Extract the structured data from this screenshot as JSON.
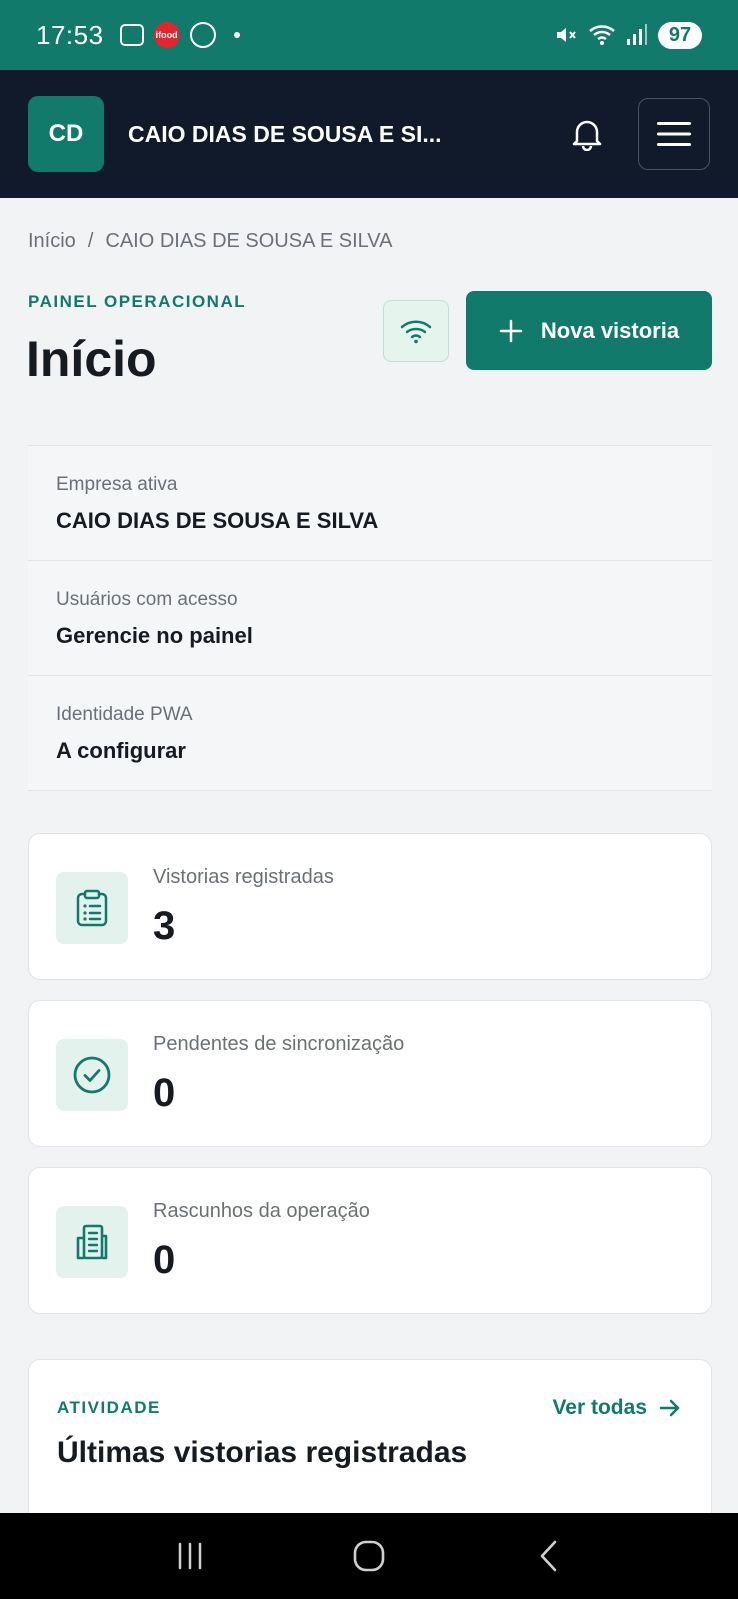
{
  "status_bar": {
    "time": "17:53",
    "battery": "97",
    "notification_icons": [
      "gallery-icon",
      "ifood-icon",
      "whatsapp-icon"
    ],
    "ifood_label": "ifood"
  },
  "header": {
    "avatar_initials": "CD",
    "company_name": "CAIO DIAS DE SOUSA E SI..."
  },
  "breadcrumb": {
    "home": "Início",
    "separator": "/",
    "current": "CAIO DIAS DE SOUSA E SILVA"
  },
  "page": {
    "section_label": "PAINEL OPERACIONAL",
    "title": "Início",
    "new_inspection_label": "Nova vistoria"
  },
  "info": [
    {
      "label": "Empresa ativa",
      "value": "CAIO DIAS DE SOUSA E SILVA"
    },
    {
      "label": "Usuários com acesso",
      "value": "Gerencie no painel"
    },
    {
      "label": "Identidade PWA",
      "value": "A configurar"
    }
  ],
  "stats": [
    {
      "label": "Vistorias registradas",
      "value": "3",
      "icon": "clipboard-icon"
    },
    {
      "label": "Pendentes de sincronização",
      "value": "0",
      "icon": "check-circle-icon"
    },
    {
      "label": "Rascunhos da operação",
      "value": "0",
      "icon": "building-icon"
    }
  ],
  "activity": {
    "label": "ATIVIDADE",
    "title": "Últimas vistorias registradas",
    "see_all": "Ver todas"
  },
  "colors": {
    "brand": "#117a6b",
    "header_bg": "#111a2b",
    "page_bg": "#f2f3f4"
  }
}
